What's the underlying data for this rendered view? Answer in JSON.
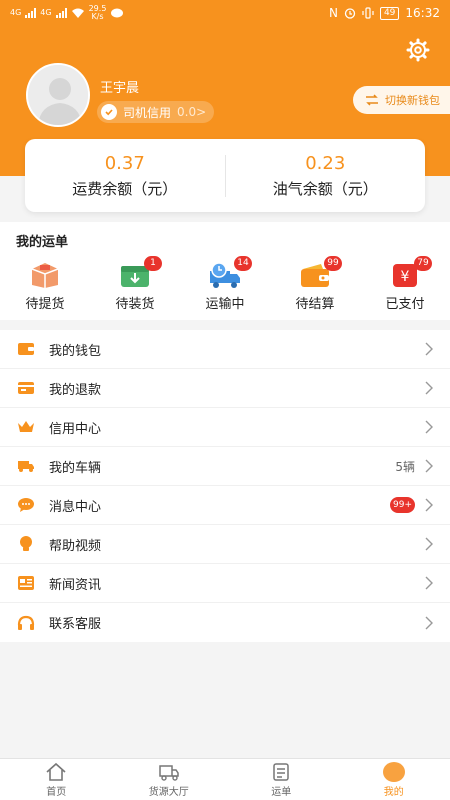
{
  "status_bar": {
    "net1": "4G",
    "net2": "4G",
    "speed": "29.5",
    "speed_unit": "K/s",
    "battery": "49",
    "time": "16:32"
  },
  "profile": {
    "name": "王宇晨",
    "credit_label": "司机信用",
    "credit_score": "0.0>",
    "switch_wallet": "切换新钱包"
  },
  "balances": [
    {
      "value": "0.37",
      "label": "运费余额（元）"
    },
    {
      "value": "0.23",
      "label": "油气余额（元）"
    }
  ],
  "orders": {
    "title": "我的运单",
    "items": [
      {
        "label": "待提货",
        "badge": "",
        "icon": "box-icon"
      },
      {
        "label": "待装货",
        "badge": "1",
        "icon": "download-box-icon"
      },
      {
        "label": "运输中",
        "badge": "14",
        "icon": "truck-clock-icon"
      },
      {
        "label": "待结算",
        "badge": "99",
        "icon": "wallet-icon"
      },
      {
        "label": "已支付",
        "badge": "79",
        "icon": "yen-icon"
      }
    ]
  },
  "menu": [
    {
      "label": "我的钱包",
      "extra": "",
      "badge": "",
      "icon": "wallet-icon"
    },
    {
      "label": "我的退款",
      "extra": "",
      "badge": "",
      "icon": "card-icon"
    },
    {
      "label": "信用中心",
      "extra": "",
      "badge": "",
      "icon": "crown-icon"
    },
    {
      "label": "我的车辆",
      "extra": "5辆",
      "badge": "",
      "icon": "truck-icon"
    },
    {
      "label": "消息中心",
      "extra": "",
      "badge": "99+",
      "icon": "chat-icon"
    },
    {
      "label": "帮助视频",
      "extra": "",
      "badge": "",
      "icon": "bulb-icon"
    },
    {
      "label": "新闻资讯",
      "extra": "",
      "badge": "",
      "icon": "news-icon"
    },
    {
      "label": "联系客服",
      "extra": "",
      "badge": "",
      "icon": "headset-icon"
    }
  ],
  "tabs": [
    {
      "label": "首页",
      "icon": "home-icon",
      "active": false
    },
    {
      "label": "货源大厅",
      "icon": "truck-icon",
      "active": false
    },
    {
      "label": "运单",
      "icon": "list-icon",
      "active": false
    },
    {
      "label": "我的",
      "icon": "user-icon",
      "active": true
    }
  ],
  "colors": {
    "accent": "#f7921e",
    "badge": "#e8342c",
    "background": "#f4f4f4"
  }
}
